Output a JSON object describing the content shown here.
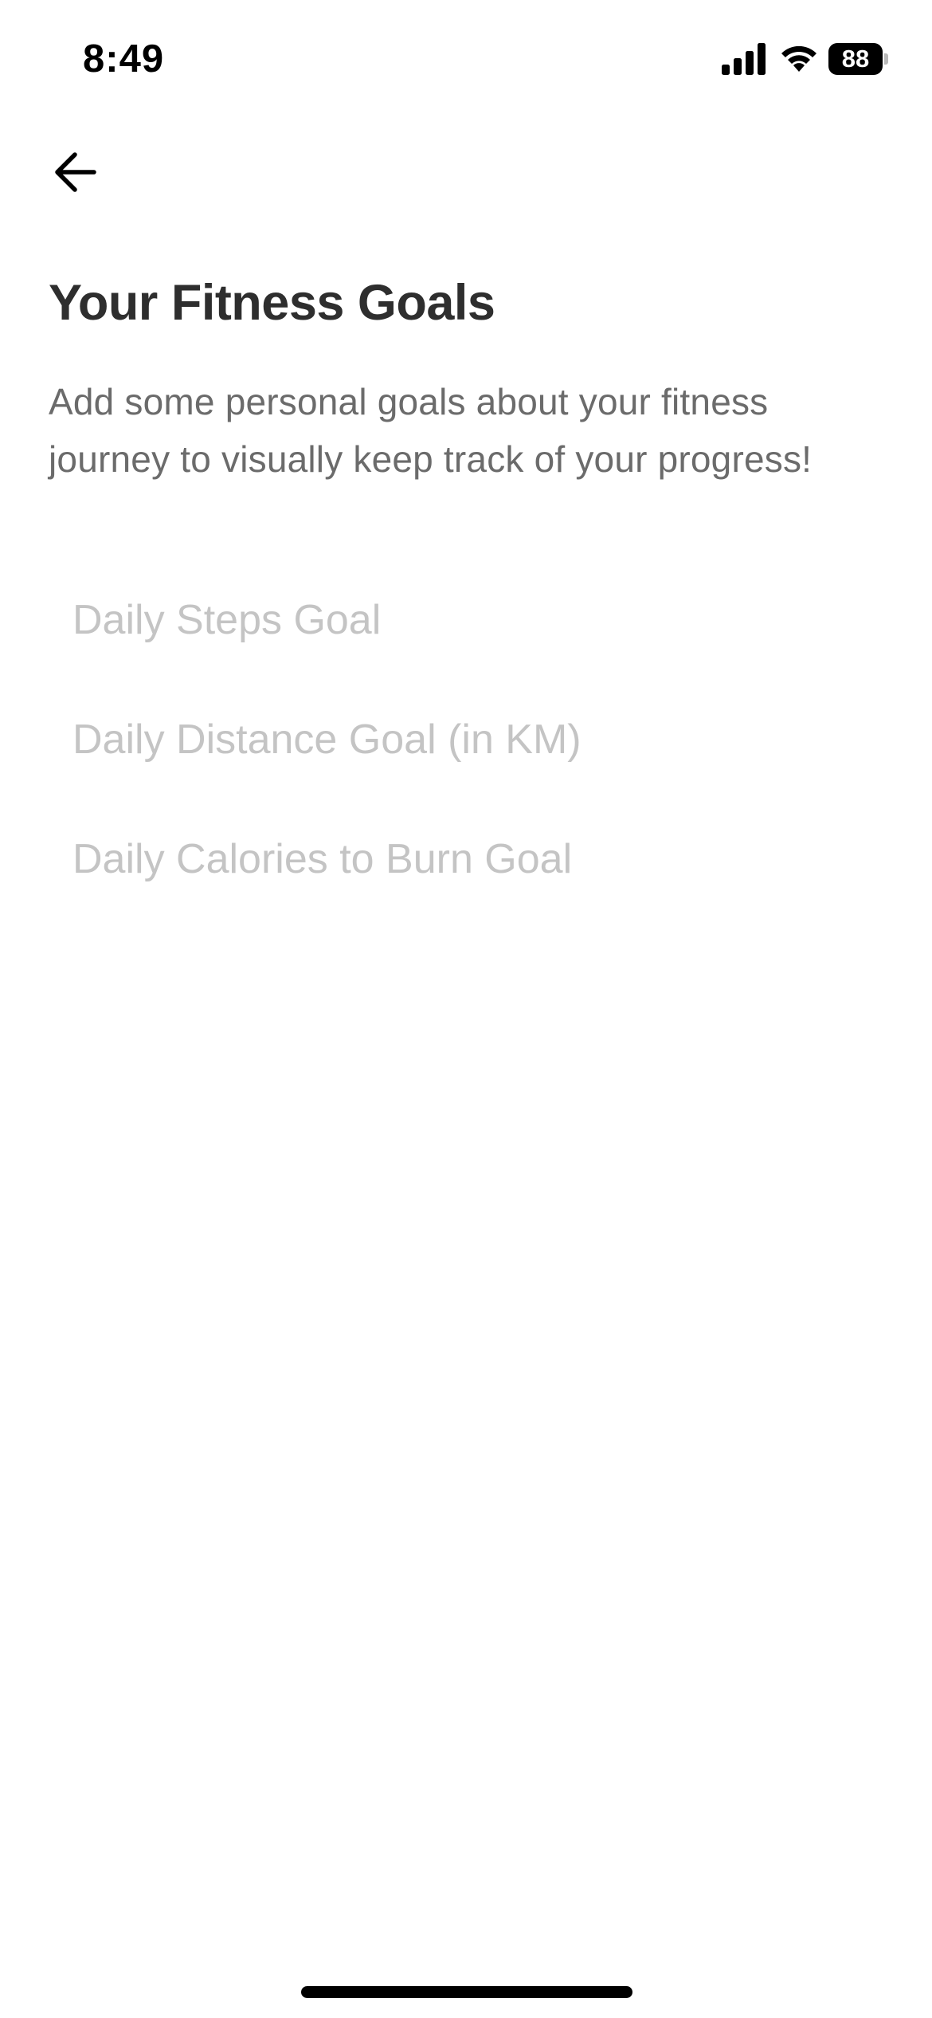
{
  "status_bar": {
    "time": "8:49",
    "battery_level": "88",
    "signal_icon": "cellular-signal-icon",
    "wifi_icon": "wifi-icon",
    "battery_icon": "battery-icon"
  },
  "navigation": {
    "back_icon": "arrow-left-icon"
  },
  "header": {
    "title": "Your Fitness Goals",
    "description": "Add some personal goals about your fitness journey to visually keep track of your progress!"
  },
  "goals": {
    "steps": {
      "value": "",
      "placeholder": "Daily Steps Goal"
    },
    "distance": {
      "value": "",
      "placeholder": "Daily Distance Goal (in KM)"
    },
    "calories": {
      "value": "",
      "placeholder": "Daily Calories to Burn Goal"
    }
  },
  "colors": {
    "title": "#2e2e2e",
    "description": "#6b6b6b",
    "placeholder": "#c4c4c4",
    "background": "#ffffff"
  }
}
